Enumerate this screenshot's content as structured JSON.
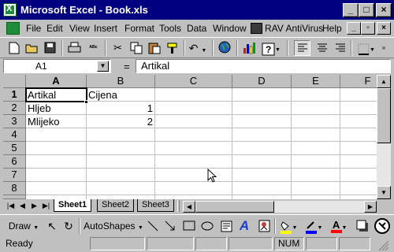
{
  "window": {
    "title": "Microsoft Excel - Book.xls",
    "app_icon_glyph": "X",
    "controls": [
      "_",
      "□",
      "×"
    ]
  },
  "menu": {
    "items": [
      "File",
      "Edit",
      "View",
      "Insert",
      "Format",
      "Tools",
      "Data",
      "Window",
      "RAV AntiVirus",
      "Help"
    ],
    "doc_controls": [
      "_",
      "▫",
      "×"
    ]
  },
  "toolbar": {
    "icons": [
      "new-icon",
      "open-icon",
      "save-icon",
      "print-icon",
      "spelling-icon",
      "cut-icon",
      "copy-icon",
      "paste-icon",
      "format-painter-icon",
      "undo-icon",
      "web-icon",
      "chart-wizard-icon",
      "help-icon",
      "align-left-icon",
      "align-center-icon",
      "align-right-icon",
      "borders-icon"
    ]
  },
  "formula_bar": {
    "name_box": "A1",
    "equals": "=",
    "content": "Artikal"
  },
  "grid": {
    "columns": [
      "A",
      "B",
      "C",
      "D",
      "E",
      "F"
    ],
    "rows": [
      "1",
      "2",
      "3",
      "4",
      "5",
      "6",
      "7",
      "8"
    ],
    "active_cell": "A1",
    "cells": {
      "A1": "Artikal",
      "B1": "Cijena",
      "A2": "Hljeb",
      "B2": "1",
      "A3": "Mlijeko",
      "B3": "2"
    }
  },
  "sheets": {
    "tabs": [
      "Sheet1",
      "Sheet2",
      "Sheet3"
    ],
    "active": "Sheet1"
  },
  "drawing_toolbar": {
    "draw_label": "Draw",
    "autoshapes_label": "AutoShapes",
    "fill_color": "#ffff00",
    "line_color": "#0000ff",
    "font_color": "#ff0000",
    "font_glyph": "A"
  },
  "status": {
    "ready": "Ready",
    "num": "NUM"
  },
  "colors": {
    "titlebar": "#000080",
    "chrome": "#c0c0c0",
    "excel_green": "#1f8c3b"
  }
}
